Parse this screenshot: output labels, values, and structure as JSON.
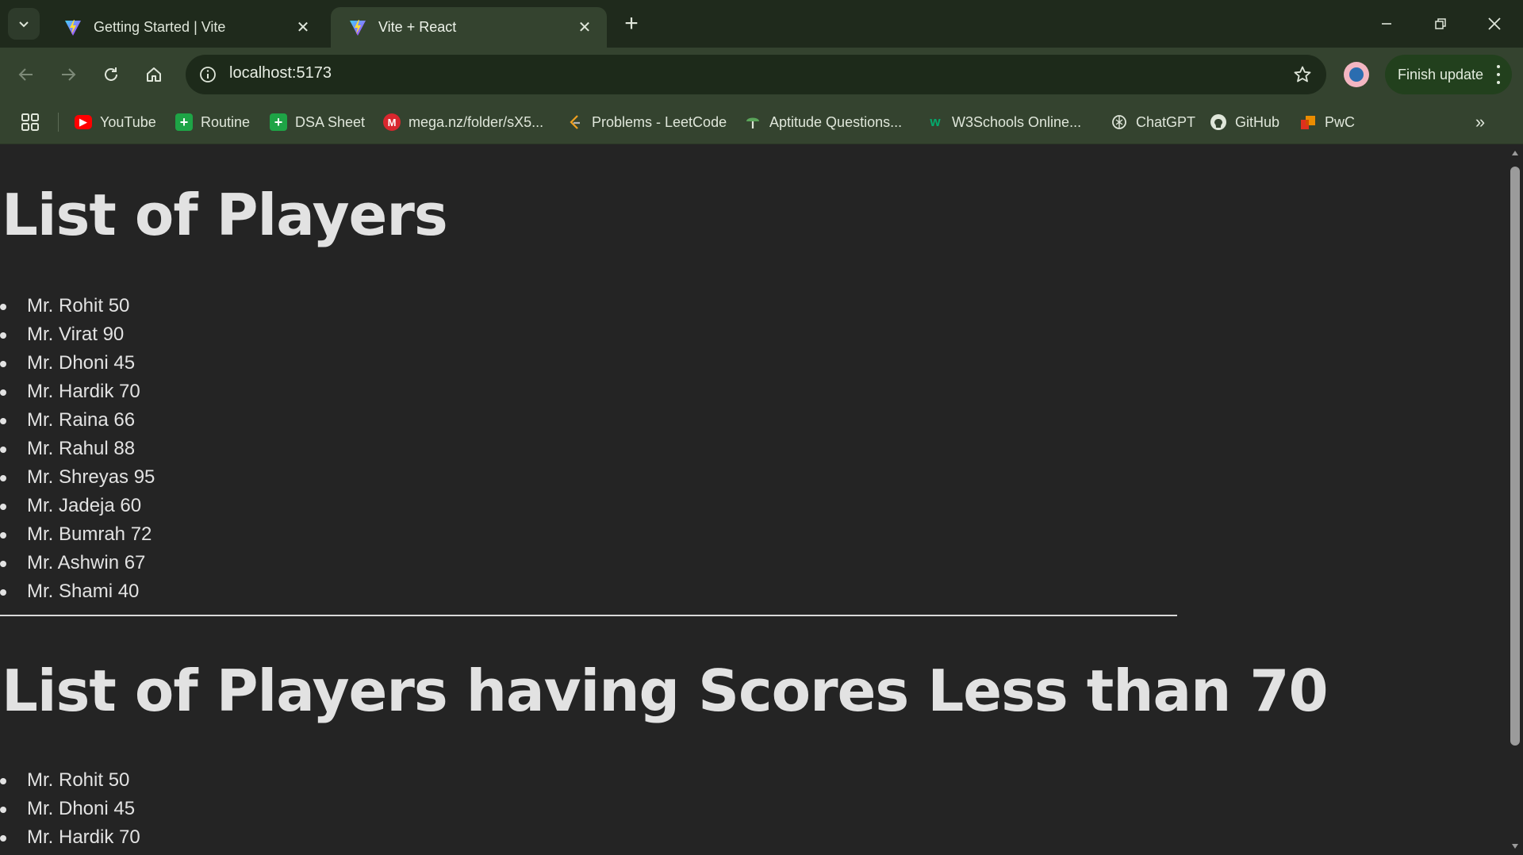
{
  "browser": {
    "tabs": [
      {
        "title": "Getting Started | Vite",
        "active": false
      },
      {
        "title": "Vite + React",
        "active": true
      }
    ],
    "new_tab_label": "+",
    "address": "localhost:5173",
    "finish_update_label": "Finish update",
    "bookmarks": [
      {
        "label": "YouTube",
        "icon": "youtube-icon",
        "color": "#ff0000"
      },
      {
        "label": "Routine",
        "icon": "sheets-icon",
        "color": "#1ea446"
      },
      {
        "label": "DSA Sheet",
        "icon": "sheets-icon",
        "color": "#1ea446"
      },
      {
        "label": "mega.nz/folder/sX5...",
        "icon": "mega-icon",
        "color": "#d9272e"
      },
      {
        "label": "Problems - LeetCode",
        "icon": "leetcode-icon",
        "color": "#f0a020"
      },
      {
        "label": "Aptitude Questions...",
        "icon": "indiabix-icon",
        "color": "#5aa55a"
      },
      {
        "label": "W3Schools Online...",
        "icon": "w3schools-icon",
        "color": "#04aa6d"
      },
      {
        "label": "ChatGPT",
        "icon": "chatgpt-icon",
        "color": "#dfe6da"
      },
      {
        "label": "GitHub",
        "icon": "github-icon",
        "color": "#dfe6da"
      },
      {
        "label": "PwC",
        "icon": "pwc-icon",
        "color": "#e0301e"
      }
    ],
    "colors": {
      "frame": "#1f2a1c",
      "toolbar": "#34432f",
      "omnibox": "#1d2a1a",
      "page_bg": "#242424"
    }
  },
  "page": {
    "heading_all": "List of Players",
    "players_all": [
      "Mr. Rohit 50",
      "Mr. Virat 90",
      "Mr. Dhoni 45",
      "Mr. Hardik 70",
      "Mr. Raina 66",
      "Mr. Rahul 88",
      "Mr. Shreyas 95",
      "Mr. Jadeja 60",
      "Mr. Bumrah 72",
      "Mr. Ashwin 67",
      "Mr. Shami 40"
    ],
    "heading_filtered": "List of Players having Scores Less than 70",
    "players_filtered": [
      "Mr. Rohit 50",
      "Mr. Dhoni 45",
      "Mr. Hardik 70"
    ]
  }
}
